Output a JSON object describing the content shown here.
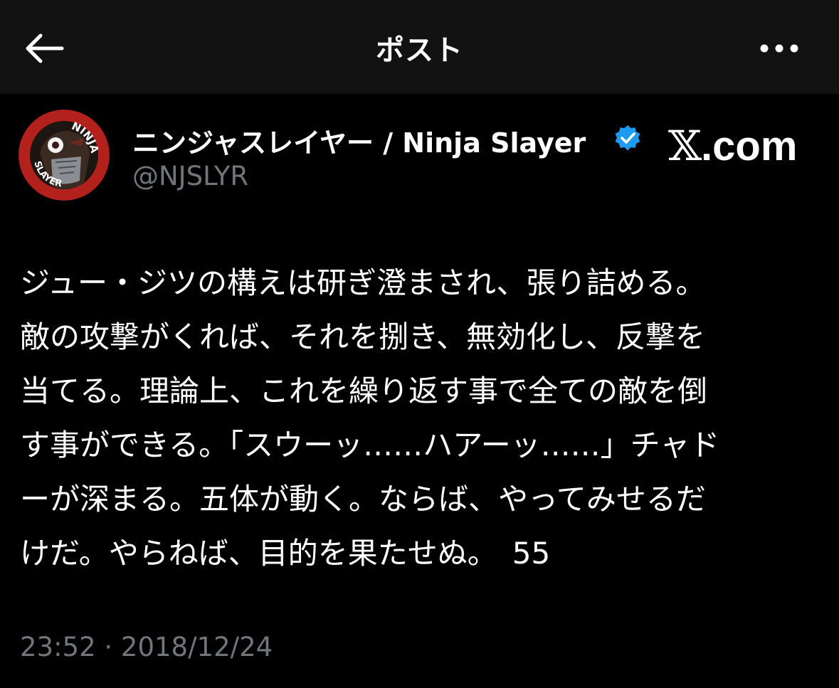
{
  "header": {
    "title": "ポスト",
    "back_icon": "arrow-left-icon",
    "more_icon": "more-horizontal-icon"
  },
  "author": {
    "display_name": "ニンジャスレイヤー / Ninja Slayer",
    "handle": "@NJSLYR",
    "verified_icon": "verified-badge-icon",
    "verified_color": "#1d9bf0",
    "avatar_text_top": "NINJA",
    "avatar_text_bottom": "SLAYER"
  },
  "watermark": {
    "x_glyph": "𝕏",
    "suffix": ".com"
  },
  "post": {
    "lines": [
      "ジュー・ジツの構えは研ぎ澄まされ、張り詰める。",
      "敵の攻撃がくれば、それを捌き、無効化し、反撃を",
      "当てる。理論上、これを繰り返す事で全ての敵を倒",
      "す事ができる。「スウーッ……ハアーッ……」チャド",
      "ーが深まる。五体が動く。ならば、やってみせるだ",
      "けだ。やらねば、目的を果たせぬ。　55"
    ]
  },
  "meta": {
    "timestamp": "23:52 · 2018/12/24"
  },
  "colors": {
    "background": "#000000",
    "header_background": "#121212",
    "primary_text": "#ffffff",
    "secondary_text": "#71767b",
    "avatar_red": "#b3211c"
  }
}
